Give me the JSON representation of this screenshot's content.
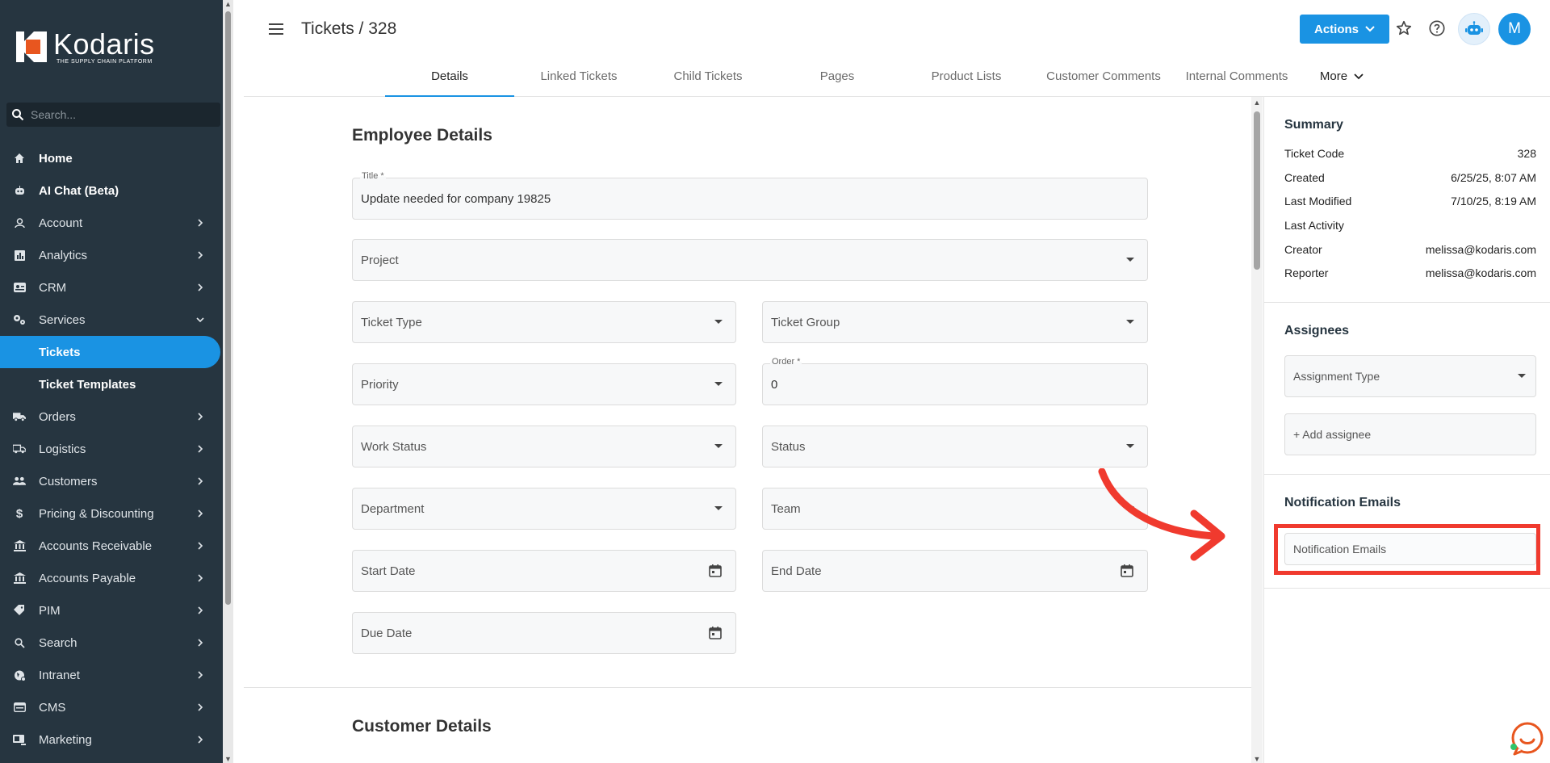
{
  "sidebar": {
    "logo": {
      "name": "Kodaris",
      "tagline": "THE SUPPLY CHAIN PLATFORM"
    },
    "search_placeholder": "Search...",
    "items": [
      {
        "label": "Home",
        "icon": "home-icon",
        "chevron": false
      },
      {
        "label": "AI Chat (Beta)",
        "icon": "robot-icon",
        "chevron": false
      },
      {
        "label": "Account",
        "icon": "user-icon",
        "chevron": true
      },
      {
        "label": "Analytics",
        "icon": "chart-icon",
        "chevron": true
      },
      {
        "label": "CRM",
        "icon": "id-card-icon",
        "chevron": true
      },
      {
        "label": "Services",
        "icon": "gears-icon",
        "chevron": "down"
      },
      {
        "label": "Tickets",
        "sub": true,
        "active": true
      },
      {
        "label": "Ticket Templates",
        "sub": true
      },
      {
        "label": "Orders",
        "icon": "truck-icon",
        "chevron": true
      },
      {
        "label": "Logistics",
        "icon": "delivery-icon",
        "chevron": true
      },
      {
        "label": "Customers",
        "icon": "people-icon",
        "chevron": true
      },
      {
        "label": "Pricing & Discounting",
        "icon": "dollar-icon",
        "chevron": true
      },
      {
        "label": "Accounts Receivable",
        "icon": "bank-icon",
        "chevron": true
      },
      {
        "label": "Accounts Payable",
        "icon": "bank-icon",
        "chevron": true
      },
      {
        "label": "PIM",
        "icon": "tag-icon",
        "chevron": true
      },
      {
        "label": "Search",
        "icon": "search-icon",
        "chevron": true
      },
      {
        "label": "Intranet",
        "icon": "globe-icon",
        "chevron": true
      },
      {
        "label": "CMS",
        "icon": "browser-icon",
        "chevron": true
      },
      {
        "label": "Marketing",
        "icon": "megaphone-icon",
        "chevron": true
      }
    ]
  },
  "header": {
    "title": "Tickets / 328",
    "actions_label": "Actions",
    "avatar_initial": "M",
    "tabs": [
      "Details",
      "Linked Tickets",
      "Child Tickets",
      "Pages",
      "Product Lists",
      "Customer Comments",
      "Internal Comments"
    ],
    "more_label": "More"
  },
  "employee_details": {
    "heading": "Employee Details",
    "title_label": "Title *",
    "title_value": "Update needed for company 19825",
    "project": "Project",
    "ticket_type": "Ticket Type",
    "ticket_group": "Ticket Group",
    "priority": "Priority",
    "order_label": "Order *",
    "order_value": "0",
    "work_status": "Work Status",
    "status": "Status",
    "department": "Department",
    "team": "Team",
    "start_date": "Start Date",
    "end_date": "End Date",
    "due_date": "Due Date"
  },
  "customer_details": {
    "heading": "Customer Details"
  },
  "summary": {
    "heading": "Summary",
    "rows": [
      {
        "label": "Ticket Code",
        "value": "328"
      },
      {
        "label": "Created",
        "value": "6/25/25, 8:07 AM"
      },
      {
        "label": "Last Modified",
        "value": "7/10/25, 8:19 AM"
      },
      {
        "label": "Last Activity",
        "value": ""
      },
      {
        "label": "Creator",
        "value": "melissa@kodaris.com"
      },
      {
        "label": "Reporter",
        "value": "melissa@kodaris.com"
      }
    ]
  },
  "assignees": {
    "heading": "Assignees",
    "assignment_type": "Assignment Type",
    "add_assignee": "+ Add assignee"
  },
  "notification_emails": {
    "heading": "Notification Emails",
    "placeholder": "Notification Emails"
  },
  "colors": {
    "sidebar_bg": "#263540",
    "accent": "#1a93e3",
    "annotation": "#f03a2e"
  }
}
